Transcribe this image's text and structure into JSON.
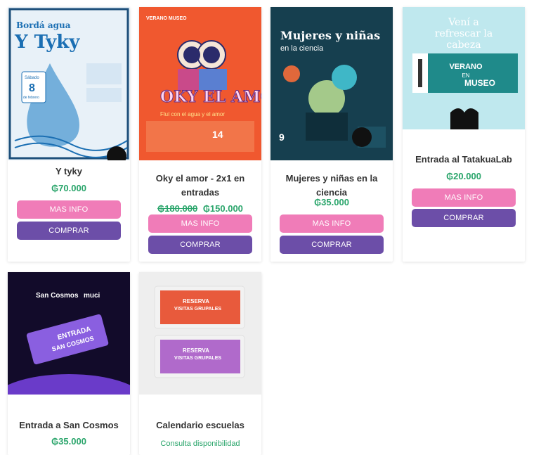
{
  "products": [
    {
      "title": "Y tyky",
      "price": "₲70.000",
      "poster": {
        "heading": "Bordá agua",
        "big": "Y Tyky",
        "day_label": "Sábado",
        "day": "8",
        "month": "de febrero"
      },
      "more_info_label": "MAS INFO",
      "buy_label": "COMPRAR"
    },
    {
      "title_line1": "Oky el amor - 2x1 en",
      "title_line2": "entradas",
      "old_price": "₲180.000",
      "price": "₲150.000",
      "poster": {
        "top": "VERANO MUSEO",
        "big": "OKY EL AMOR",
        "sub": "Fluí con el agua y el amor",
        "date": "14"
      },
      "more_info_label": "MAS INFO",
      "buy_label": "COMPRAR"
    },
    {
      "title_line1": "Mujeres y niñas en la",
      "title_line2": "ciencia",
      "price": "₲35.000",
      "poster": {
        "big1": "Mujeres y niñas",
        "big2": "en la ciencia",
        "date": "9"
      },
      "more_info_label": "MAS INFO",
      "buy_label": "COMPRAR"
    },
    {
      "title": "Entrada al TatakuaLab",
      "price": "₲20.000",
      "poster": {
        "line1": "Vení a",
        "line2": "refrescar la",
        "line3": "cabeza",
        "ticket1": "VERANO",
        "ticket2": "EN",
        "ticket3": "MUSEO"
      },
      "more_info_label": "MAS INFO",
      "buy_label": "COMPRAR"
    },
    {
      "title": "Entrada a San Cosmos",
      "price": "₲35.000",
      "poster": {
        "brand": "San Cosmos",
        "brand2": "muci",
        "ticket1": "ENTRADA",
        "ticket2": "SAN COSMOS"
      }
    },
    {
      "title": "Calendario escuelas",
      "consult": "Consulta disponibilidad",
      "poster": {
        "t1": "RESERVA",
        "t2": "VISITAS GRUPALES"
      }
    }
  ],
  "colors": {
    "pink": "#f07cb8",
    "purple": "#6c4ea8",
    "green": "#2aa56b"
  }
}
